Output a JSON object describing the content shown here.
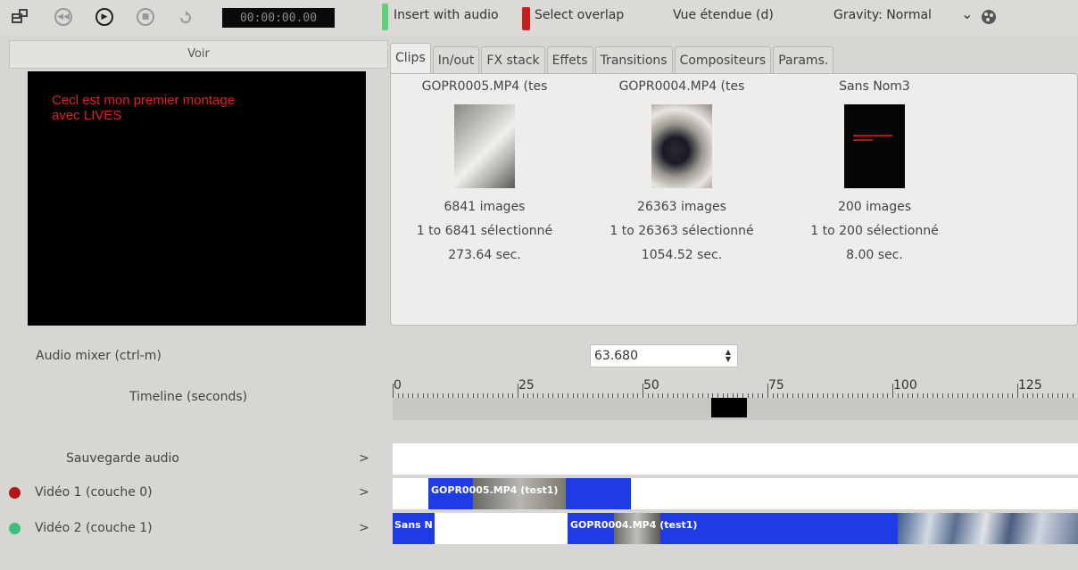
{
  "toolbar": {
    "timecode": "00:00:00.00",
    "insert_with_audio": "Insert with audio",
    "select_overlap": "Select overlap",
    "vue_etendue": "Vue étendue (d)",
    "gravity": "Gravity: Normal",
    "gravity_chevron": "⌄"
  },
  "preview": {
    "header": "Voir",
    "overlay_text": "Cecl est mon premier montage\navec LIVES"
  },
  "tabs": [
    "Clips",
    "In/out",
    "FX stack",
    "Effets",
    "Transitions",
    "Compositeurs",
    "Params."
  ],
  "clips": [
    {
      "name": "GOPR0005.MP4 (tes",
      "frames": "6841 images",
      "selection": "1 to 6841 sélectionné",
      "duration": "273.64 sec."
    },
    {
      "name": "GOPR0004.MP4 (tes",
      "frames": "26363 images",
      "selection": "1 to 26363 sélectionné",
      "duration": "1054.52 sec."
    },
    {
      "name": "Sans Nom3",
      "frames": "200 images",
      "selection": "1 to 200 sélectionné",
      "duration": "8.00 sec."
    }
  ],
  "audio_mixer_label": "Audio mixer (ctrl-m)",
  "time_value": "63.680",
  "timeline_label": "Timeline (seconds)",
  "ruler_labels": [
    "0",
    "25",
    "50",
    "75",
    "100",
    "125"
  ],
  "tracks": {
    "audio": {
      "label": "Sauvegarde audio",
      "chevron": ">"
    },
    "video1": {
      "label": "Vidéo 1 (couche 0)",
      "chevron": ">",
      "block_label": "GOPR0005.MP4 (test1)",
      "dot_color": "#b01818"
    },
    "video2": {
      "label": "Vidéo 2 (couche 1)",
      "chevron": ">",
      "block1_label": "Sans N",
      "block2_label": "GOPR0004.MP4 (test1)",
      "dot_color": "#3cc07a"
    }
  },
  "colors": {
    "accent_blue": "#1f3be6",
    "insert_green": "#5fcf7a",
    "overlap_red": "#c81e1e"
  }
}
